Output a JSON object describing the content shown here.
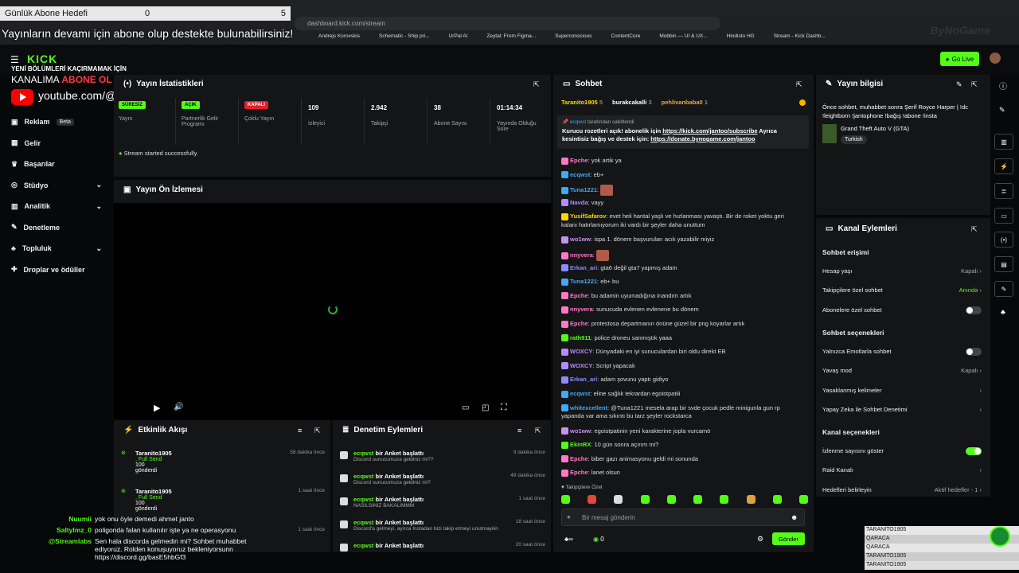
{
  "browser": {
    "url": "dashboard.kick.com/stream",
    "bookmarks": [
      "Andrejs Korovskis",
      "Schematic - Ship pri...",
      "UrPal AI",
      "Zeytal: From Figma...",
      "Superconscious",
      "ContentCore",
      "Mobbin — UI & UX...",
      "Hindisto HG",
      "Stream - Kick Dashb..."
    ]
  },
  "overlay": {
    "goal_label": "Günlük Abone Hedefi",
    "goal_current": "0",
    "goal_target": "5",
    "banner": "Yayınların devamı için abone olup destekte bulunabilirsiniz!",
    "brand": "ByNoGame",
    "promo_line1": "YENİ BÖLÜMLERİ KAÇIRMAMAK İÇİN",
    "promo_line2a": "KANALIMA ",
    "promo_line2b": "ABONE OL",
    "youtube": "youtube.com/@imjanto"
  },
  "topnav": {
    "logo": "KICK",
    "go_live": "Go Live"
  },
  "sidebar": {
    "items": [
      {
        "label": "Reklam",
        "badge": "Beta"
      },
      {
        "label": "Gelir"
      },
      {
        "label": "Başarılar"
      },
      {
        "label": "Stüdyo",
        "chev": "⌄"
      },
      {
        "label": "Analitik",
        "chev": "⌄"
      },
      {
        "label": "Denetleme"
      },
      {
        "label": "Topluluk",
        "chev": "⌄"
      },
      {
        "label": "Droplar ve ödüller"
      }
    ]
  },
  "stats": {
    "title": "Yayın İstatistikleri",
    "items": [
      {
        "pill": "SÜRESİZ",
        "pill_color": "#53fc18",
        "label": "Yayın"
      },
      {
        "pill": "AÇIK",
        "pill_color": "#53fc18",
        "label": "Partnerlik Gelir Programı"
      },
      {
        "pill": "KAPALI",
        "pill_color": "#e0202a",
        "label": "Çoklu Yayın"
      },
      {
        "value": "109",
        "label": "İzleyici"
      },
      {
        "value": "2.942",
        "label": "Takipçi"
      },
      {
        "value": "38",
        "label": "Abone Sayısı"
      },
      {
        "value": "01:14:34",
        "label": "Yayında Olduğu Süre"
      }
    ],
    "status": "Stream started successfully."
  },
  "preview": {
    "title": "Yayın Ön İzlemesi"
  },
  "activity": {
    "title": "Etkinlik Akışı",
    "items": [
      {
        "user": "Taranito1905",
        "action": ", Full Send",
        "amount": "100",
        "note": "gönderdi",
        "time": "58 dakika önce"
      },
      {
        "user": "Taranito1905",
        "action": ", Full Send",
        "amount": "100",
        "note": "gönderdi",
        "time": "1 saat önce"
      },
      {
        "user": "",
        "action": "",
        "amount": "",
        "note": "",
        "time": "1 saat önce"
      }
    ]
  },
  "moderation": {
    "title": "Denetim Eylemleri",
    "items": [
      {
        "user": "ecqwst",
        "action": "bir Anket başlattı",
        "detail": "Discord sunucumuza geldiniz mi??",
        "time": "9 dakika önce"
      },
      {
        "user": "ecqwst",
        "action": "bir Anket başlattı",
        "detail": "Discord sunucumuza geldiniz mi?",
        "time": "49 dakika önce"
      },
      {
        "user": "ecqwst",
        "action": "bir Anket başlattı",
        "detail": "NASILSINIZ BAKALIMMM",
        "time": "1 saat önce"
      },
      {
        "user": "ecqwst",
        "action": "bir Anket başlattı",
        "detail": "Discord'a gelmeyi, ayrıca Instadan bizi takip etmeyi unutmayiiin",
        "time": "18 saat önce"
      },
      {
        "user": "ecqwst",
        "action": "bir Anket başlattı",
        "detail": "",
        "time": "20 saat önce"
      }
    ]
  },
  "chat": {
    "title": "Sohbet",
    "top": [
      {
        "name": "Taranito1905",
        "n": "5"
      },
      {
        "name": "burakcakalli",
        "n": "3"
      },
      {
        "name": "pehlivanbaba0",
        "n": "1"
      }
    ],
    "pinned_by": "ecqwst",
    "pinned_suffix": " tarafından sabitlendi",
    "pinned_text1": "Kurucu rozetleri açık! abonelik için ",
    "pinned_link1": "https://kick.com/jantoo/subscribe",
    "pinned_text2": " Ayrıca kesintisiz bağış ve destek için: ",
    "pinned_link2": "https://donate.bynogame.com/jantoo",
    "messages": [
      {
        "user": "Epche",
        "color": "#ff79c6",
        "text": "yok artik ya"
      },
      {
        "user": "ecqwst",
        "color": "#3fa9f5",
        "text": "eb+"
      },
      {
        "user": "Tuna1221",
        "color": "#3fa9f5",
        "text": ""
      },
      {
        "user": "Navda",
        "color": "#b48cff",
        "text": "vayy"
      },
      {
        "user": "YusifSafarov",
        "color": "#ffd700",
        "text": "evet heli hantal yaşlı ve hızlanması yavaştı. Bir de roket yoktu geri kalanı hatırlamıyorum iki vardı bir şeyler daha unuttum"
      },
      {
        "user": "wo1ww",
        "color": "#c792ea",
        "text": "ispa 1. dönem başvuruları acık yazabilir miyiz"
      },
      {
        "user": "nnyvera",
        "color": "#ff79c6",
        "text": ""
      },
      {
        "user": "Erkan_ari",
        "color": "#8c8cff",
        "text": "gta6 değil gta7 yapmış adam"
      },
      {
        "user": "Tuna1221",
        "color": "#3fa9f5",
        "text": "eb+ bu"
      },
      {
        "user": "Epche",
        "color": "#ff79c6",
        "text": "bu adamin uyumadığına inandım artık"
      },
      {
        "user": "nnyvera",
        "color": "#ff79c6",
        "text": "sunucuda evlenen evlenene bu dönem"
      },
      {
        "user": "Epche",
        "color": "#ff79c6",
        "text": "protestosa departmanın önüne güzel bir png koyarlar artık"
      },
      {
        "user": "rath911",
        "color": "#53fc18",
        "text": "police droneu sanmıştık yaaa"
      },
      {
        "user": "WOXCY",
        "color": "#b48cff",
        "text": "Dünyadaki en iyi sunuculardan biri oldu direkt EB"
      },
      {
        "user": "WOXCY",
        "color": "#b48cff",
        "text": "Script yapacak"
      },
      {
        "user": "Erkan_ari",
        "color": "#8c8cff",
        "text": "adam şovunu yaptı gidiyo"
      },
      {
        "user": "ecqwst",
        "color": "#3fa9f5",
        "text": "eline sağlık tekrardan egoistpatiii"
      },
      {
        "user": "whitexcellent",
        "color": "#3fa9f5",
        "text": "@Tuna1221 mesela arap bir svde çocuk pedle minigunla gun rp yapanda var ama sıkıntı bu tarz şeyler rockstarca"
      },
      {
        "user": "wo1ww",
        "color": "#c792ea",
        "text": "egoistpatinin yeni karakterine jopla vurcamö"
      },
      {
        "user": "EkinRX",
        "color": "#53fc18",
        "text": "10 gün sonra açırım mi?"
      },
      {
        "user": "Epche",
        "color": "#ff79c6",
        "text": "biber gazı animasyonu geldi mi sonunda"
      },
      {
        "user": "Epche",
        "color": "#ff79c6",
        "text": "lanet olsun"
      }
    ],
    "followers_only": "Takipçilere Özel",
    "input_placeholder": "Bir mesaj gönderin",
    "count": "0",
    "send": "Gönder"
  },
  "streaminfo": {
    "title": "Yayın bilgisi",
    "text": "Önce sohbet, muhabbet sonra Şerif Royce Harper | !dc !leightborn !jantophone !bağış !abone !insta",
    "game": "Grand Theft Auto V (GTA)",
    "tag": "Turkish"
  },
  "actions": {
    "title": "Kanal Eylemleri",
    "sec1": "Sohbet erişimi",
    "rows1": [
      {
        "label": "Hesap yaşı",
        "value": "Kapalı"
      },
      {
        "label": "Takipçilere özel sohbet",
        "value": "Anında"
      },
      {
        "label": "Abonelere özel sohbet",
        "toggle": "off"
      }
    ],
    "sec2": "Sohbet seçenekleri",
    "rows2": [
      {
        "label": "Yalnızca Emotlarla sohbet",
        "toggle": "off"
      },
      {
        "label": "Yavaş mod",
        "value": "Kapalı"
      },
      {
        "label": "Yasaklanmış kelimeler"
      },
      {
        "label": "Yapay Zeka ile Sohbet Denetimi"
      }
    ],
    "sec3": "Kanal seçenekleri",
    "rows3": [
      {
        "label": "İzlenme sayısını göster",
        "toggle": "on"
      },
      {
        "label": "Raid Kanalı"
      },
      {
        "label": "Hedefleri belirleyin",
        "value": "Aktif hedefler - 1"
      }
    ]
  },
  "overlay_chat": [
    {
      "user": "Nuumii",
      "text": "yok onu öyle demedi ahmet janto"
    },
    {
      "user": "Saltylmz_0",
      "text": "poligonda falan kullanılır işte ya ne operasyonu"
    },
    {
      "user": "@Streamlabs",
      "text": "Sen hala discorda gelmedin mi? Sohbet muhabbet ediyoruz. Rolden konuşuyoruz bekleniyorsunn https://discord.gg/basE5hbGf3"
    }
  ],
  "leaderboard": [
    "TARANITO1905",
    "QARACA",
    "QARACA",
    "TARANITO1905",
    "TARANITO1905"
  ]
}
